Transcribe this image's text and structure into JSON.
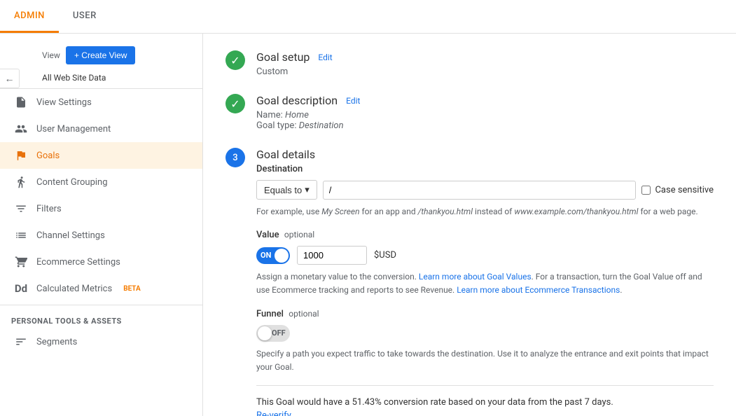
{
  "topNav": {
    "tabs": [
      {
        "id": "admin",
        "label": "ADMIN",
        "active": true
      },
      {
        "id": "user",
        "label": "USER",
        "active": false
      }
    ]
  },
  "sidebar": {
    "view_label": "View",
    "create_view_btn": "+ Create View",
    "all_site": "All Web Site Data",
    "items": [
      {
        "id": "view-settings",
        "label": "View Settings",
        "icon": "doc-icon"
      },
      {
        "id": "user-management",
        "label": "User Management",
        "icon": "people-icon"
      },
      {
        "id": "goals",
        "label": "Goals",
        "icon": "flag-icon",
        "active": true
      },
      {
        "id": "content-grouping",
        "label": "Content Grouping",
        "icon": "person-icon"
      },
      {
        "id": "filters",
        "label": "Filters",
        "icon": "filter-icon"
      },
      {
        "id": "channel-settings",
        "label": "Channel Settings",
        "icon": "channel-icon"
      },
      {
        "id": "ecommerce-settings",
        "label": "Ecommerce Settings",
        "icon": "cart-icon"
      },
      {
        "id": "calculated-metrics",
        "label": "Calculated Metrics",
        "icon": "calc-icon",
        "badge": "BETA"
      }
    ],
    "personal_tools_section": "PERSONAL TOOLS & ASSETS",
    "personal_items": [
      {
        "id": "segments",
        "label": "Segments",
        "icon": "segments-icon"
      }
    ]
  },
  "goalSetup": {
    "step1": {
      "title": "Goal setup",
      "edit_label": "Edit",
      "subtitle": "Custom",
      "completed": true
    },
    "step2": {
      "title": "Goal description",
      "edit_label": "Edit",
      "name_label": "Name:",
      "name_value": "Home",
      "type_label": "Goal type:",
      "type_value": "Destination",
      "completed": true
    },
    "step3": {
      "number": "3",
      "title": "Goal details",
      "destination_label": "Destination",
      "equals_to": "Equals to",
      "destination_value": "/",
      "case_sensitive_label": "Case sensitive",
      "hint_text": "For example, use ",
      "hint_my_screen": "My Screen",
      "hint_middle": " for an app and ",
      "hint_thankyou": "/thankyou.html",
      "hint_instead": " instead of ",
      "hint_example": "www.example.com/thankyou.html",
      "hint_end": " for a web page.",
      "value_label": "Value",
      "value_optional": "optional",
      "toggle_on_label": "ON",
      "value_amount": "1000",
      "currency": "$USD",
      "value_body": "Assign a monetary value to the conversion. ",
      "goal_values_link": "Learn more about Goal Values",
      "value_body2": ". For a transaction, turn the Goal Value off and use Ecommerce tracking and reports to see Revenue. ",
      "ecommerce_link": "Learn more about Ecommerce Transactions",
      "value_body3": ".",
      "funnel_label": "Funnel",
      "funnel_optional": "optional",
      "toggle_off_label": "OFF",
      "funnel_hint": "Specify a path you expect traffic to take towards the destination. Use it to analyze the entrance and exit points that impact your Goal.",
      "conversion_text": "This Goal would have a 51.43% conversion rate based on your data from the past 7 days.",
      "re_verify_label": "Re-verify"
    }
  }
}
